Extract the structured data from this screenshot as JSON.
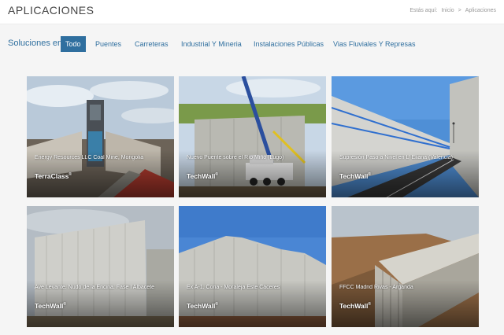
{
  "header": {
    "title": "APLICACIONES",
    "breadcrumb": {
      "prefix": "Estás aquí:",
      "home": "Inicio",
      "separator": ">",
      "current": "Aplicaciones"
    }
  },
  "filters": {
    "label": "Soluciones en:",
    "items": [
      {
        "label": "Todo",
        "active": true
      },
      {
        "label": "Puentes",
        "active": false
      },
      {
        "label": "Carreteras",
        "active": false
      },
      {
        "label": "Industrial Y Mineria",
        "active": false
      },
      {
        "label": "Instalaciones Públicas",
        "active": false
      },
      {
        "label": "Vias Fluviales Y Represas",
        "active": false
      }
    ]
  },
  "projects": [
    {
      "title": "Energy Resources LLC Coal Mine, Mongolia",
      "brand": "TerraClass",
      "trademark": "®"
    },
    {
      "title": "Nuevo Puente sobre el Río Miño (Lugo)",
      "brand": "TechWall",
      "trademark": "®"
    },
    {
      "title": "Supresión Paso a Nivel en L' Eliana (Valencia)",
      "brand": "TechWall",
      "trademark": "®"
    },
    {
      "title": "Ave Levante. Nudo de la Encina. Fase I Albacete",
      "brand": "TechWall",
      "trademark": "®"
    },
    {
      "title": "Ex A-1. Coria - Moraleja Este Cáceres",
      "brand": "TechWall",
      "trademark": "®"
    },
    {
      "title": "FFCC Madrid Rivas - Arganda",
      "brand": "TechWall",
      "trademark": "®"
    }
  ],
  "colors": {
    "accent": "#2f6f9f",
    "page_background": "#f5f5f5"
  }
}
